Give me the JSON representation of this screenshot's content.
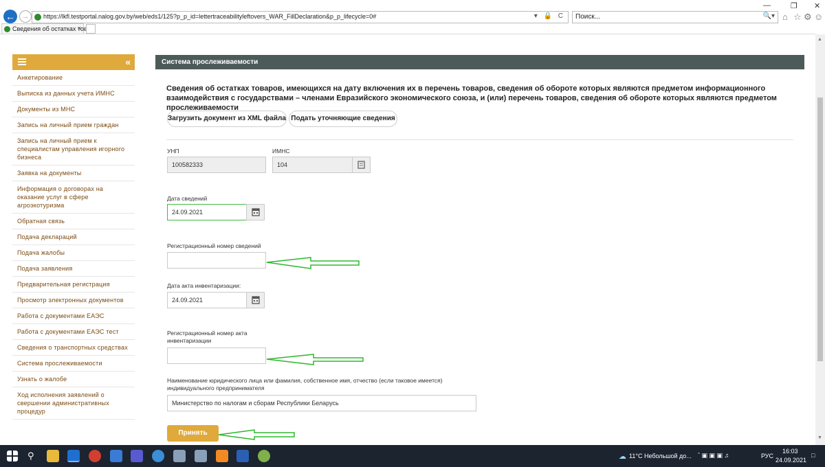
{
  "browser": {
    "url": "https://lkfl.testportal.nalog.gov.by/web/eds1/125?p_p_id=lettertraceabilityleftovers_WAR_FillDeclaration&p_p_lifecycle=0#",
    "search_placeholder": "Поиск...",
    "tab_title": "Сведения об остатках това...",
    "tab_close": "×",
    "address_tools": "▾ 🔒 C",
    "search_icon": "🔍▾",
    "window_controls": [
      "—",
      "❐",
      "✕"
    ],
    "toolbar_icons": [
      "home-icon",
      "star-icon",
      "gear-icon",
      "smiley-icon"
    ]
  },
  "sidebar": {
    "collapse_glyph": "«",
    "items": [
      "Анкетирование",
      "Выписка из данных учета ИМНС",
      "Документы из МНС",
      "Запись на личный прием граждан",
      "Запись на личный прием к специалистам управления игорного бизнеса",
      "Заявка на документы",
      "Информация о договорах на оказание услуг в сфере агроэкотуризма",
      "Обратная связь",
      "Подача деклараций",
      "Подача жалобы",
      "Подача заявления",
      "Предварительная регистрация",
      "Просмотр электронных документов",
      "Работа с документами ЕАЭС",
      "Работа с документами ЕАЭС тест",
      "Сведения о транспортных средствах",
      "Система прослеживаемости",
      "Узнать о жалобе",
      "Ход исполнения заявлений о свершении административных процедур"
    ]
  },
  "panel": {
    "header": "Система прослеживаемости",
    "title": "Сведения об остатках товаров, имеющихся на дату включения их в перечень товаров, сведения об обороте которых являются предметом информационного взаимодействия с государствами – членами Евразийского экономического союза, и (или) перечень товаров, сведения об обороте которых являются предметом прослеживаемости",
    "buttons": {
      "upload_xml": "Загрузить документ из XML файла",
      "clarify": "Подать уточняющие сведения",
      "submit": "Принять"
    },
    "form": {
      "unp_label": "УНП",
      "unp_value": "100582333",
      "imns_label": "ИМНС",
      "imns_value": "104",
      "date_label": "Дата сведений",
      "date_value": "24.09.2021",
      "reg_num_label": "Регистрационный номер сведений",
      "reg_num_value": "",
      "inv_date_label": "Дата акта инвентаризации:",
      "inv_date_value": "24.09.2021",
      "inv_reg_label": "Регистрационный номер акта инвентаризации",
      "inv_reg_value": "",
      "name_label": "Наименование юридического лица или фамилия, собственное имя, отчество (если таковое имеется) индивидуального предпринимателя",
      "name_value": "Министерство по налогам и сборам Республики Беларусь"
    }
  },
  "taskbar": {
    "weather": "11°C  Небольшой до...",
    "lang": "РУС",
    "time": "16:03",
    "date": "24.09.2021"
  },
  "colors": {
    "accent": "#e0a93c",
    "panel_header": "#4d5a5a",
    "menu_text": "#7a4a12",
    "annotation_arrow": "#2eb82e"
  }
}
